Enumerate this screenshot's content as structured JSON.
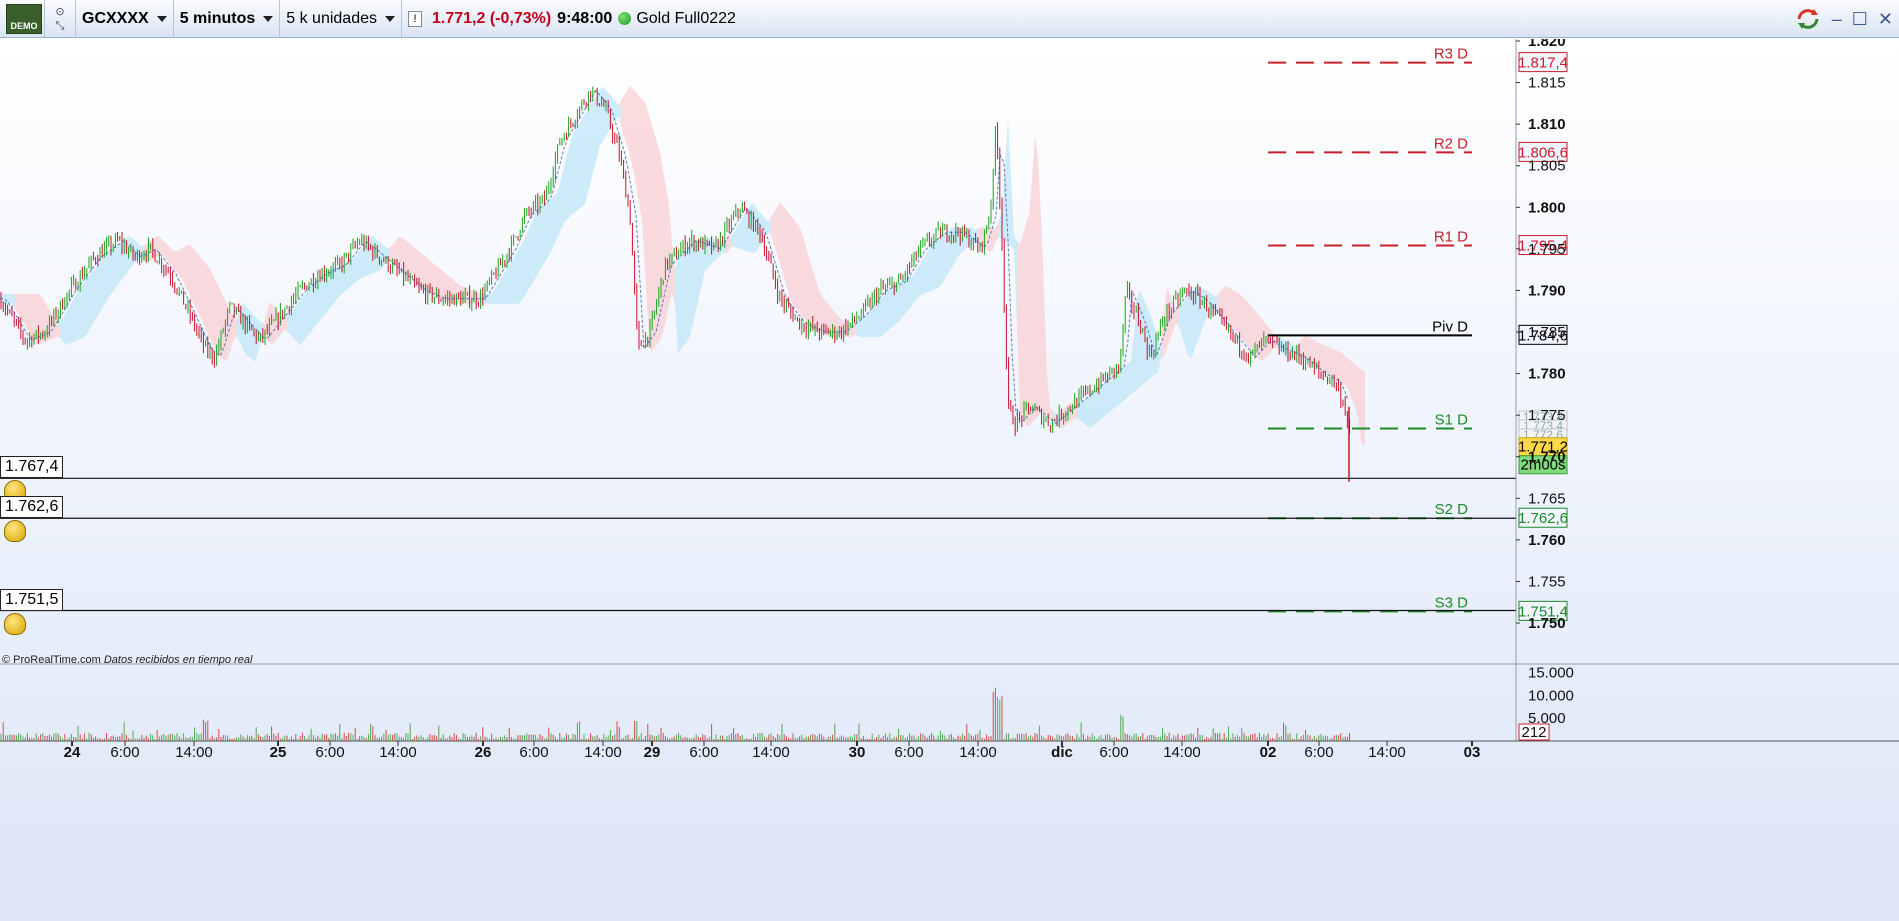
{
  "toolbar": {
    "demo_label": "DEMO",
    "symbol": "GCXXXX",
    "timeframe": "5 minutos",
    "units": "5 k unidades",
    "info_glyph": "!",
    "last_price": "1.771,2 (-0,73%)",
    "time": "9:48:00",
    "instrument_name": "Gold Full0222",
    "icons": [
      "demo-logo",
      "link-icon",
      "info-icon",
      "status-dot",
      "sync-icon",
      "minimize-icon",
      "maximize-icon",
      "close-icon"
    ],
    "win_minimize": "–",
    "win_maximize": "☐",
    "win_close": "✕"
  },
  "chart_data": {
    "type": "candlestick",
    "instrument": "GCXXXX",
    "timeframe": "5 minutos",
    "y_axis": {
      "ticks": [
        "1.820",
        "1.815",
        "1.810",
        "1.805",
        "1.800",
        "1.795",
        "1.790",
        "1.785",
        "1.780",
        "1.775",
        "1.770",
        "1.765",
        "1.760",
        "1.755",
        "1.750"
      ],
      "ylim": [
        1749,
        1821
      ]
    },
    "x_axis": {
      "ticks": [
        "24",
        "6:00",
        "14:00",
        "25",
        "6:00",
        "14:00",
        "26",
        "6:00",
        "14:00",
        "29",
        "6:00",
        "14:00",
        "30",
        "6:00",
        "14:00",
        "dic",
        "6:00",
        "14:00",
        "02",
        "6:00",
        "14:00",
        "03"
      ],
      "bold_ticks": [
        "24",
        "25",
        "26",
        "29",
        "30",
        "dic",
        "02",
        "03"
      ]
    },
    "price_path": [
      [
        0,
        1789
      ],
      [
        25,
        1784
      ],
      [
        45,
        1785
      ],
      [
        70,
        1790
      ],
      [
        95,
        1794
      ],
      [
        118,
        1796
      ],
      [
        135,
        1794
      ],
      [
        150,
        1795
      ],
      [
        170,
        1792
      ],
      [
        190,
        1787
      ],
      [
        205,
        1783
      ],
      [
        215,
        1782
      ],
      [
        230,
        1788
      ],
      [
        245,
        1786
      ],
      [
        260,
        1784
      ],
      [
        280,
        1787
      ],
      [
        300,
        1790
      ],
      [
        320,
        1792
      ],
      [
        340,
        1793
      ],
      [
        360,
        1796
      ],
      [
        380,
        1794
      ],
      [
        400,
        1792
      ],
      [
        420,
        1790
      ],
      [
        440,
        1789
      ],
      [
        480,
        1789
      ],
      [
        495,
        1792
      ],
      [
        510,
        1795
      ],
      [
        525,
        1799
      ],
      [
        545,
        1801
      ],
      [
        560,
        1808
      ],
      [
        575,
        1811
      ],
      [
        590,
        1814
      ],
      [
        605,
        1812
      ],
      [
        620,
        1806
      ],
      [
        630,
        1799
      ],
      [
        638,
        1783
      ],
      [
        650,
        1785
      ],
      [
        665,
        1793
      ],
      [
        690,
        1796
      ],
      [
        715,
        1795
      ],
      [
        740,
        1800
      ],
      [
        760,
        1797
      ],
      [
        780,
        1789
      ],
      [
        800,
        1786
      ],
      [
        820,
        1785
      ],
      [
        840,
        1785
      ],
      [
        860,
        1787
      ],
      [
        880,
        1790
      ],
      [
        900,
        1791
      ],
      [
        920,
        1795
      ],
      [
        940,
        1797
      ],
      [
        960,
        1797
      ],
      [
        980,
        1795
      ],
      [
        990,
        1799
      ],
      [
        996,
        1810
      ],
      [
        1002,
        1796
      ],
      [
        1008,
        1776
      ],
      [
        1015,
        1774
      ],
      [
        1030,
        1776
      ],
      [
        1050,
        1774
      ],
      [
        1070,
        1776
      ],
      [
        1090,
        1778
      ],
      [
        1110,
        1780
      ],
      [
        1120,
        1781
      ],
      [
        1126,
        1790
      ],
      [
        1140,
        1786
      ],
      [
        1150,
        1782
      ],
      [
        1165,
        1787
      ],
      [
        1185,
        1790
      ],
      [
        1200,
        1789
      ],
      [
        1215,
        1787
      ],
      [
        1235,
        1784
      ],
      [
        1250,
        1782
      ],
      [
        1265,
        1784
      ],
      [
        1280,
        1783
      ],
      [
        1300,
        1782
      ],
      [
        1320,
        1780
      ],
      [
        1335,
        1779
      ],
      [
        1345,
        1776
      ],
      [
        1350,
        1772
      ]
    ],
    "last_price": "1.771,2",
    "countdown": "2m00s",
    "volume_last": "212",
    "volume_ticks": [
      "15.000",
      "10.000",
      "5.000"
    ],
    "pivot_levels": [
      {
        "label": "R3 D",
        "value": 1817.4,
        "value_label": "1.817,4",
        "color": "#c8202a",
        "style": "dashed"
      },
      {
        "label": "R2 D",
        "value": 1806.6,
        "value_label": "1.806,6",
        "color": "#c8202a",
        "style": "dashed"
      },
      {
        "label": "R1 D",
        "value": 1795.4,
        "value_label": "1.795,4",
        "color": "#c8202a",
        "style": "dashed"
      },
      {
        "label": "Piv D",
        "value": 1784.6,
        "value_label": "1.784,6",
        "color": "#000000",
        "style": "solid"
      },
      {
        "label": "S1 D",
        "value": 1773.4,
        "value_label": "",
        "color": "#1a8a2a",
        "style": "dashed"
      },
      {
        "label": "S2 D",
        "value": 1762.6,
        "value_label": "1.762,6",
        "color": "#1a8a2a",
        "style": "dashed"
      },
      {
        "label": "S3 D",
        "value": 1751.4,
        "value_label": "1.751,4",
        "color": "#1a8a2a",
        "style": "dashed"
      }
    ],
    "right_tags_small": [
      "1.773,8",
      "1.773,4",
      "1.772,6",
      "1.771,7"
    ],
    "alerts": [
      {
        "value": 1767.4,
        "label": "1.767,4"
      },
      {
        "value": 1762.6,
        "label": "1.762,6"
      },
      {
        "value": 1751.5,
        "label": "1.751,5"
      }
    ],
    "colors": {
      "up": "#1aa31a",
      "down": "#c8102e",
      "cloud_up": "#bfe6f7",
      "cloud_down": "#f9cfd3",
      "volume_up": "#35a035",
      "volume_down": "#d03030"
    }
  },
  "footer": {
    "copyright": "© ProRealTime.com",
    "status": "Datos recibidos en tiempo real"
  }
}
